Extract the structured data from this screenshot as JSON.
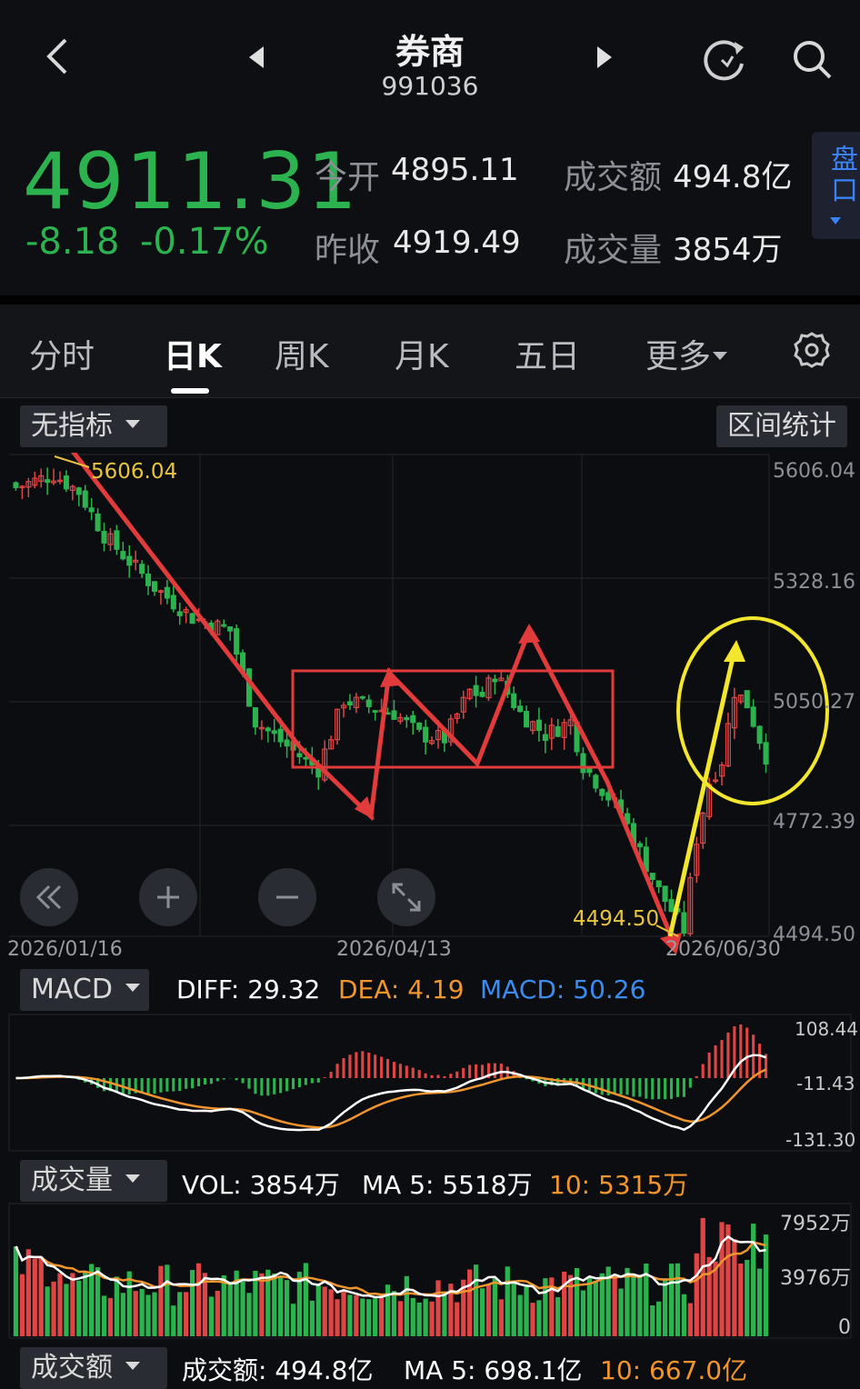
{
  "header": {
    "title": "券商",
    "code": "991036",
    "price": "4911.31",
    "change": "-8.18",
    "change_pct": "-0.17%",
    "open_label": "今开",
    "open_value": "4895.11",
    "prev_close_label": "昨收",
    "prev_close_value": "4919.49",
    "turnover_label": "成交额",
    "turnover_value": "494.8亿",
    "volume_label": "成交量",
    "volume_value": "3854万",
    "panel_button": "盘口",
    "colors": {
      "down": "#2cb34f",
      "up": "#e04545"
    }
  },
  "tabs": [
    "分时",
    "日K",
    "周K",
    "月K",
    "五日",
    "更多"
  ],
  "active_tab": "日K",
  "toolbar": {
    "indicator_select": "无指标",
    "range_stats_button": "区间统计"
  },
  "kline": {
    "y_axis_labels": [
      "5606.04",
      "5328.16",
      "5050.27",
      "4772.39",
      "4494.50"
    ],
    "x_axis_labels": [
      "2026/01/16",
      "2026/04/13",
      "2026/06/30"
    ],
    "high_marker": "5606.04",
    "low_marker": "4494.50"
  },
  "macd": {
    "select": "MACD",
    "diff": "DIFF: 29.32",
    "dea": "DEA: 4.19",
    "macd": "MACD: 50.26",
    "y_axis_labels": [
      "108.44",
      "-11.43",
      "-131.30"
    ]
  },
  "volume": {
    "select": "成交量",
    "vol": "VOL: 3854万",
    "ma5": "MA 5: 5518万",
    "ma10": "10: 5315万",
    "y_axis_labels": [
      "7952万",
      "3976万",
      "0"
    ]
  },
  "turnover_panel": {
    "select": "成交额",
    "text": "成交额: 494.8亿",
    "ma5": "MA 5: 698.1亿",
    "ma10": "10: 667.0亿"
  },
  "chart_data": {
    "type": "candlestick",
    "y_range": [
      4494.5,
      5606.04
    ],
    "x_labels": [
      "2026/01/16",
      "2026/04/13",
      "2026/06/30"
    ],
    "high": 5606.04,
    "low": 4494.5,
    "last_close": 4911.31
  }
}
